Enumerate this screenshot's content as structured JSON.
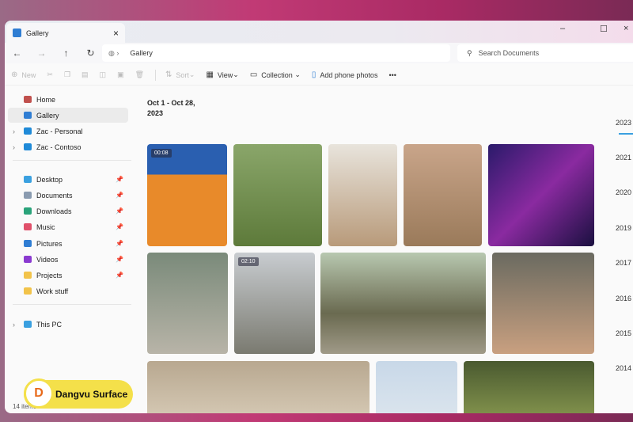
{
  "window": {
    "tab_title": "Gallery",
    "close": "×",
    "min": "–",
    "max": "☐",
    "exit": "×"
  },
  "nav": {
    "back": "←",
    "forward": "→",
    "up": "↑",
    "refresh": "↻",
    "breadcrumb": "Gallery",
    "search_placeholder": "Search Documents"
  },
  "toolbar": {
    "new": "New",
    "sort": "Sort",
    "view": "View",
    "collection": "Collection",
    "add_phone": "Add phone photos",
    "more": "•••"
  },
  "sidebar": {
    "top": [
      {
        "label": "Home",
        "color": "#c0504d"
      },
      {
        "label": "Gallery",
        "color": "#2f7dd3"
      },
      {
        "label": "Zac - Personal",
        "color": "#1f8ad8"
      },
      {
        "label": "Zac - Contoso",
        "color": "#1f8ad8"
      }
    ],
    "pinned": [
      {
        "label": "Desktop",
        "color": "#3aa0e0"
      },
      {
        "label": "Documents",
        "color": "#8a9bb0"
      },
      {
        "label": "Downloads",
        "color": "#2aa37a"
      },
      {
        "label": "Music",
        "color": "#e0506a"
      },
      {
        "label": "Pictures",
        "color": "#2f7dd3"
      },
      {
        "label": "Videos",
        "color": "#8a3ad0"
      },
      {
        "label": "Projects",
        "color": "#f2c34a"
      },
      {
        "label": "Work stuff",
        "color": "#f2c34a"
      }
    ],
    "this_pc": "This PC"
  },
  "content": {
    "date_range": "Oct 1 - Oct 28,",
    "date_year": "2023",
    "durations": [
      "00:08",
      "02:10"
    ]
  },
  "timeline": [
    "2023",
    "2021",
    "2020",
    "2019",
    "2017",
    "2016",
    "2015",
    "2014"
  ],
  "status": "14 items",
  "watermark": "Dangvu Surface"
}
